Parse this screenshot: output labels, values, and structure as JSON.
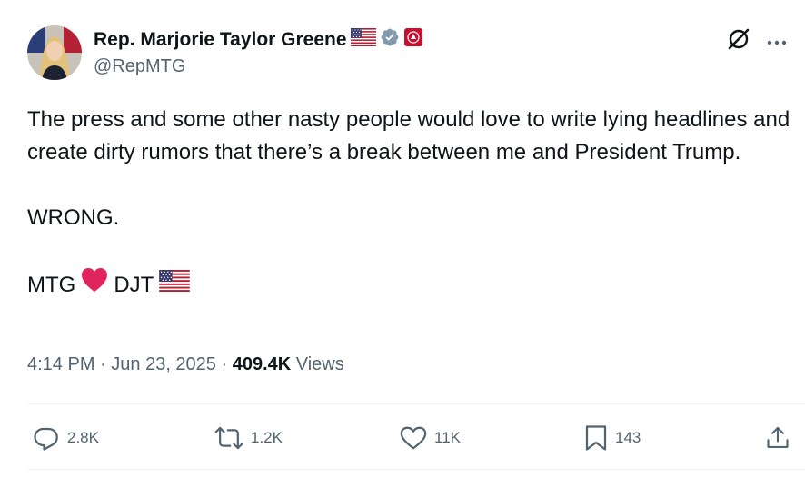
{
  "author": {
    "name": "Rep. Marjorie Taylor Greene",
    "handle": "@RepMTG",
    "icons": [
      "us-flag-icon",
      "verified-badge-icon",
      "house-seal-icon"
    ]
  },
  "tweet": {
    "line1": "The press and some other nasty people would love to write lying headlines and create dirty rumors that there’s a break between me and President Trump.",
    "line2": "WRONG.",
    "sig_left": "MTG",
    "sig_right": "DJT"
  },
  "meta": {
    "time": "4:14 PM",
    "sep1": " · ",
    "date": "Jun 23, 2025",
    "sep2": " · ",
    "views_count": "409.4K",
    "views_label": " Views"
  },
  "stats": {
    "replies": "2.8K",
    "reposts": "1.2K",
    "likes": "11K",
    "bookmarks": "143"
  },
  "colors": {
    "text": "#0f1419",
    "muted": "#536471",
    "verified": "#829aab",
    "heart": "#e0245e",
    "seal": "#c8102e"
  }
}
